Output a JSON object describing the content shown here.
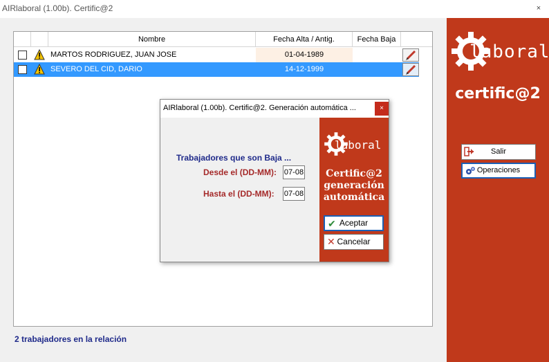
{
  "window": {
    "title": "AIRlaboral (1.00b). Certific@2",
    "close_glyph": "×"
  },
  "table": {
    "columns": [
      "Nombre",
      "Fecha Alta / Antig.",
      "Fecha Baja"
    ],
    "rows": [
      {
        "name": "MARTOS RODRIGUEZ, JUAN JOSE",
        "fecha_alta": "01-04-1989",
        "fecha_baja": "",
        "selected": false
      },
      {
        "name": "SEVERO DEL CID, DARIO",
        "fecha_alta": "14-12-1999",
        "fecha_baja": "",
        "selected": true
      }
    ]
  },
  "status": {
    "text": "2 trabajadores en la relación"
  },
  "side_panel": {
    "logo_text": "laboral",
    "title": "certific@2",
    "buttons": {
      "salir": "Salir",
      "operaciones": "Operaciones"
    }
  },
  "dialog": {
    "title": "AIRlaboral (1.00b). Certific@2. Generación automática ...",
    "close_glyph": "×",
    "heading": "Trabajadores que son Baja ...",
    "desde_label": "Desde el (DD-MM):",
    "desde_value": "07-08",
    "hasta_label": "Hasta el (DD-MM):",
    "hasta_value": "07-08",
    "logo_text": "laboral",
    "brand_line1": "Certific@2",
    "brand_line2": "generación",
    "brand_line3": "automática",
    "ok_label": "Aceptar",
    "cancel_label": "Cancelar"
  },
  "colors": {
    "brand_red": "#c0391b",
    "selection_blue": "#3399ff",
    "status_text": "#1f2a8a",
    "label_dark_red": "#a52a2a",
    "close_red": "#c42b1c"
  },
  "icons": {
    "row_warning": "warning-triangle-icon",
    "row_edit": "pencil-icon",
    "salir": "exit-arrow-icon",
    "operaciones": "gears-icon",
    "ok": "checkmark-icon",
    "cancel": "x-icon",
    "logo": "gear-icon"
  }
}
